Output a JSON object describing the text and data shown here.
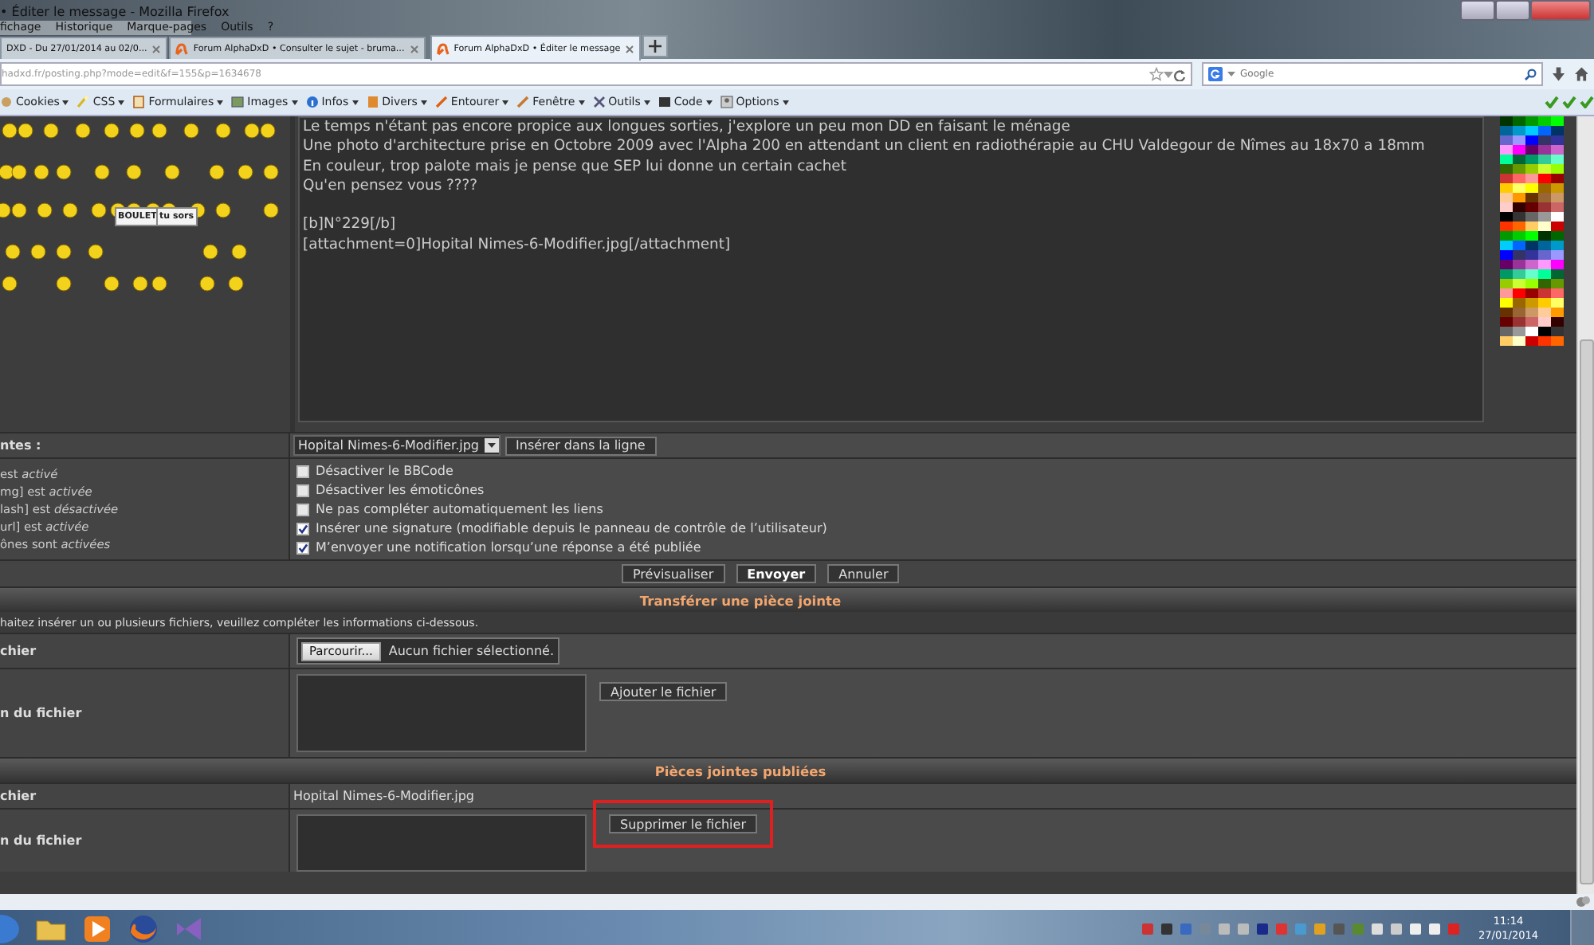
{
  "window": {
    "title": "• Éditer le message - Mozilla Firefox"
  },
  "menu": [
    "fichage",
    "Historique",
    "Marque-pages",
    "Outils",
    "?"
  ],
  "tabs": [
    {
      "label": "DXD - Du 27/01/2014 au 02/0...",
      "selected": false
    },
    {
      "label": "Forum AlphaDxD • Consulter le sujet - bruma...",
      "selected": false
    },
    {
      "label": "Forum AlphaDxD • Éditer le message",
      "selected": true
    }
  ],
  "address": {
    "url": "hadxd.fr/posting.php?mode=edit&f=155&p=1634678"
  },
  "search": {
    "placeholder": "Google"
  },
  "dev_toolbar": [
    "Cookies",
    "CSS",
    "Formulaires",
    "Images",
    "Infos",
    "Divers",
    "Entourer",
    "Fenêtre",
    "Outils",
    "Code",
    "Options"
  ],
  "smiley_signs": [
    "BOULET",
    "tu sors"
  ],
  "message": {
    "paragraphs": [
      [
        "Le temps n'étant pas encore propice aux longues sorties, j'explore un peu mon DD en faisant le ménage",
        "Une photo d'architecture prise en Octobre 2009 avec l'Alpha 200 en attendant un client en radiothérapie au CHU Valdegour de Nîmes au 18x70 a 18mm",
        "En couleur, trop palote mais je pense que SEP lui donne un certain cachet",
        "Qu'en pensez vous ????"
      ],
      [
        "[b]N°229[/b]",
        "[attachment=0]Hopital Nimes-6-Modifier.jpg[/attachment]"
      ]
    ]
  },
  "attachments_row": {
    "label": "ntes :",
    "select": "Hopital Nimes-6-Modifier.jpg",
    "button": "Insérer dans la ligne"
  },
  "status_notes": [
    "est *activé*",
    "mg] est *activée*",
    "lash] est *désactivée*",
    "url] est *activée*",
    "ônes sont *activées*"
  ],
  "options": [
    {
      "label": "Désactiver le BBCode",
      "checked": false
    },
    {
      "label": "Désactiver les émoticônes",
      "checked": false
    },
    {
      "label": "Ne pas compléter automatiquement les liens",
      "checked": false
    },
    {
      "label": "Insérer une signature (modifiable depuis le panneau de contrôle de l’utilisateur)",
      "checked": true
    },
    {
      "label": "M’envoyer une notification lorsqu’une réponse a été publiée",
      "checked": true
    }
  ],
  "actions": [
    {
      "label": "Prévisualiser",
      "primary": false
    },
    {
      "label": "Envoyer",
      "primary": true
    },
    {
      "label": "Annuler",
      "primary": false
    }
  ],
  "upload": {
    "title": "Transférer une pièce jointe",
    "hint": "haitez insérer un ou plusieurs fichiers, veuillez compléter les informations ci-dessous.",
    "file_label": "chier",
    "browse": "Parcourir...",
    "no_file": "Aucun fichier sélectionné.",
    "comment_label": "n du fichier",
    "add_button": "Ajouter le fichier"
  },
  "posted": {
    "title": "Pièces jointes publiées",
    "file_label": "chier",
    "file_name": "Hopital Nimes-6-Modifier.jpg",
    "comment_label": "n du fichier",
    "delete_button": "Supprimer le fichier",
    "highlighted": true
  },
  "taskbar": {
    "time": "11:14",
    "date": "27/01/2014"
  }
}
